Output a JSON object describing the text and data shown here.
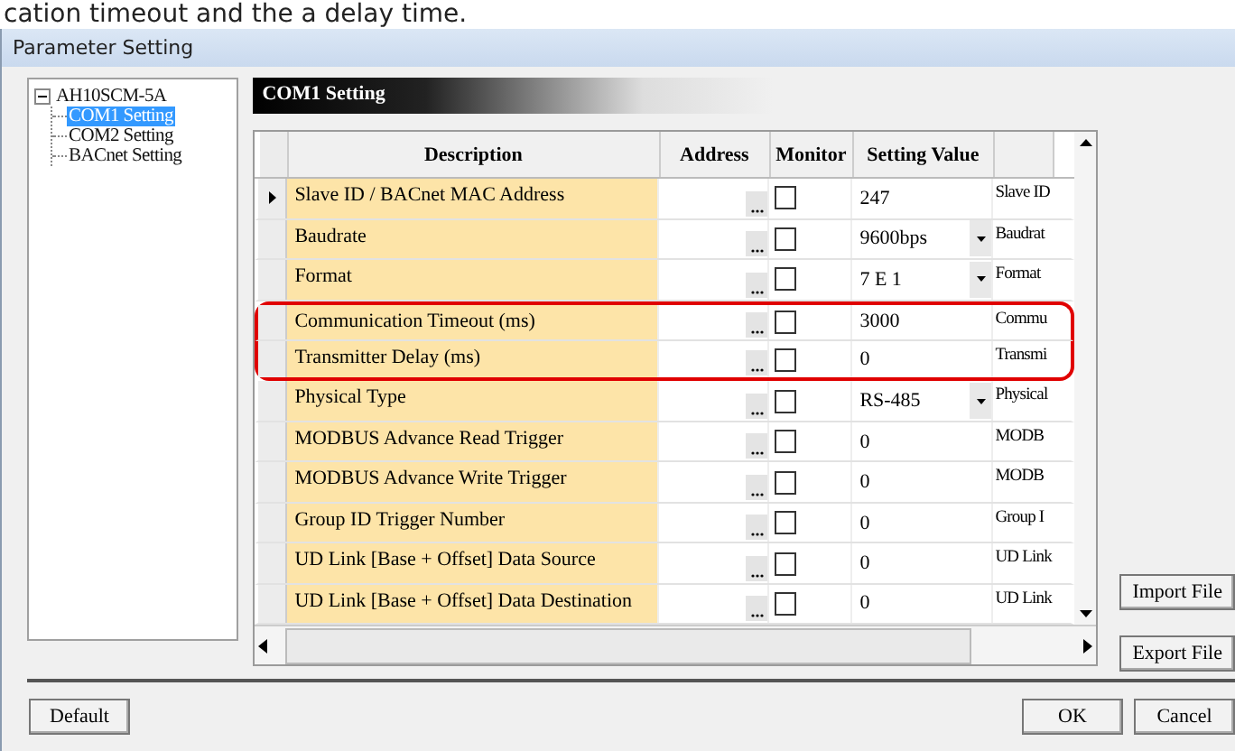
{
  "caption": "cation timeout and the a delay time.",
  "window": {
    "title": "Parameter Setting"
  },
  "tree": {
    "label": "AH10SCM-5A",
    "expanded": true,
    "children": [
      {
        "label": "COM1 Setting",
        "selected": true
      },
      {
        "label": "COM2 Setting",
        "selected": false
      },
      {
        "label": "BACnet Setting",
        "selected": false
      }
    ]
  },
  "section_title": "COM1 Setting",
  "table": {
    "columns": [
      "Description",
      "Address",
      "Monitor",
      "Setting Value"
    ],
    "rows": [
      {
        "description": "Slave ID / BACnet MAC Address",
        "monitor": false,
        "value": "247",
        "kind": "text",
        "column_5": "Slave ID",
        "current": true,
        "highlighted": false
      },
      {
        "description": "Baudrate",
        "monitor": false,
        "value": "9600bps",
        "kind": "dropdown",
        "column_5": "Baudrat",
        "current": false,
        "highlighted": false
      },
      {
        "description": "Format",
        "monitor": false,
        "value": "7  E  1",
        "kind": "dropdown",
        "column_5": "Format",
        "current": false,
        "highlighted": false
      },
      {
        "description": "Communication Timeout (ms)",
        "monitor": false,
        "value": "3000",
        "kind": "text",
        "column_5": "Commu",
        "current": false,
        "highlighted": true
      },
      {
        "description": "Transmitter Delay (ms)",
        "monitor": false,
        "value": "0",
        "kind": "text",
        "column_5": "Transmi",
        "current": false,
        "highlighted": true
      },
      {
        "description": "Physical Type",
        "monitor": false,
        "value": "RS-485",
        "kind": "dropdown",
        "column_5": "Physical",
        "current": false,
        "highlighted": false
      },
      {
        "description": "MODBUS Advance Read Trigger",
        "monitor": false,
        "value": "0",
        "kind": "text",
        "column_5": "MODB",
        "current": false,
        "highlighted": false
      },
      {
        "description": "MODBUS Advance Write Trigger",
        "monitor": false,
        "value": "0",
        "kind": "text",
        "column_5": "MODB",
        "current": false,
        "highlighted": false
      },
      {
        "description": "Group ID Trigger Number",
        "monitor": false,
        "value": "0",
        "kind": "text",
        "column_5": "Group I",
        "current": false,
        "highlighted": false
      },
      {
        "description": "UD Link [Base + Offset] Data Source",
        "monitor": false,
        "value": "0",
        "kind": "text",
        "column_5": "UD Link",
        "current": false,
        "highlighted": false
      },
      {
        "description": "UD Link [Base + Offset] Data Destination",
        "monitor": false,
        "value": "0",
        "kind": "text",
        "column_5": "UD Link",
        "current": false,
        "highlighted": false
      }
    ]
  },
  "side_buttons": [
    "Import File",
    "Export File"
  ],
  "footer": {
    "left_button": "Default",
    "buttons": [
      "OK",
      "Cancel"
    ]
  }
}
